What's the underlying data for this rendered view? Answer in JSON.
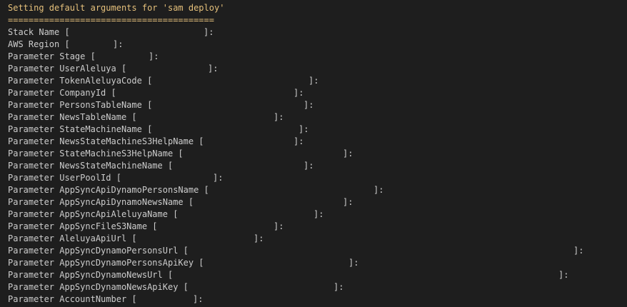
{
  "terminal": {
    "header": "Setting default arguments for 'sam deploy'",
    "separator": "=========================================",
    "prompts": [
      {
        "label": "Stack Name ["
      },
      {
        "label": "AWS Region ["
      },
      {
        "label": "Parameter Stage ["
      },
      {
        "label": "Parameter UserAleluya ["
      },
      {
        "label": "Parameter TokenAleluyaCode ["
      },
      {
        "label": "Parameter CompanyId ["
      },
      {
        "label": "Parameter PersonsTableName ["
      },
      {
        "label": "Parameter NewsTableName ["
      },
      {
        "label": "Parameter StateMachineName ["
      },
      {
        "label": "Parameter NewsStateMachineS3HelpName ["
      },
      {
        "label": "Parameter StateMachineS3HelpName ["
      },
      {
        "label": "Parameter NewsStateMachineName ["
      },
      {
        "label": "Parameter UserPoolId ["
      },
      {
        "label": "Parameter AppSyncApiDynamoPersonsName ["
      },
      {
        "label": "Parameter AppSyncApiDynamoNewsName ["
      },
      {
        "label": "Parameter AppSyncApiAleluyaName ["
      },
      {
        "label": "Parameter AppSyncFileS3Name ["
      },
      {
        "label": "Parameter AleluyaApiUrl ["
      },
      {
        "label": "Parameter AppSyncDynamoPersonsUrl ["
      },
      {
        "label": "Parameter AppSyncDynamoPersonsApiKey ["
      },
      {
        "label": "Parameter AppSyncDynamoNewsUrl ["
      },
      {
        "label": "Parameter AppSyncDynamoNewsApiKey ["
      },
      {
        "label": "Parameter AccountNumber ["
      }
    ],
    "close_bracket": "]:"
  }
}
